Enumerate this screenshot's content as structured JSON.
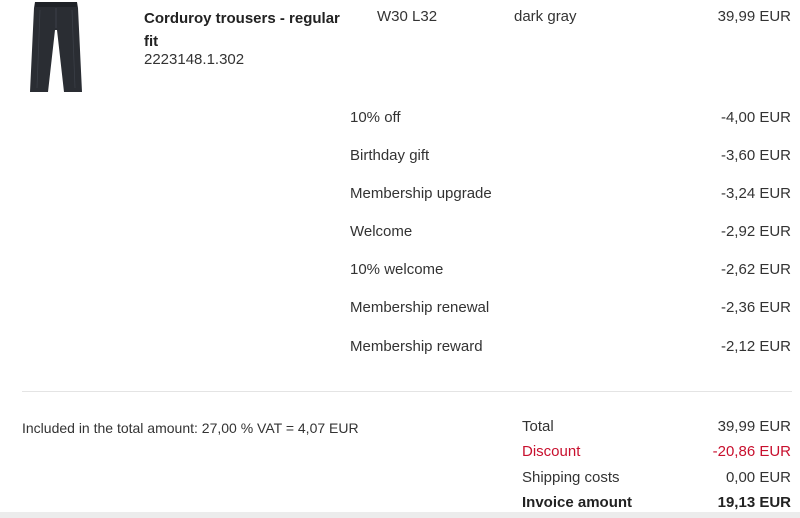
{
  "item": {
    "name": "Corduroy trousers - regular fit",
    "article_number": "2223148.1.302",
    "size": "W30 L32",
    "color": "dark gray",
    "price": "39,99 EUR",
    "image_icon": "trousers-image"
  },
  "discounts": [
    {
      "label": "10% off",
      "amount": "-4,00 EUR"
    },
    {
      "label": "Birthday gift",
      "amount": "-3,60 EUR"
    },
    {
      "label": "Membership upgrade",
      "amount": "-3,24 EUR"
    },
    {
      "label": "Welcome",
      "amount": "-2,92 EUR"
    },
    {
      "label": "10% welcome",
      "amount": "-2,62 EUR"
    },
    {
      "label": "Membership renewal",
      "amount": "-2,36 EUR"
    },
    {
      "label": "Membership reward",
      "amount": "-2,12 EUR"
    }
  ],
  "vat_note": "Included in the total amount: 27,00 % VAT =  4,07 EUR",
  "summary": {
    "total_label": "Total",
    "total_value": "39,99 EUR",
    "discount_label": "Discount",
    "discount_value": "-20,86 EUR",
    "shipping_label": "Shipping costs",
    "shipping_value": "0,00 EUR",
    "invoice_label": "Invoice amount",
    "invoice_value": "19,13 EUR"
  },
  "colors": {
    "text": "#333333",
    "discount_red": "#c8102e",
    "divider": "#e4e4e4"
  }
}
